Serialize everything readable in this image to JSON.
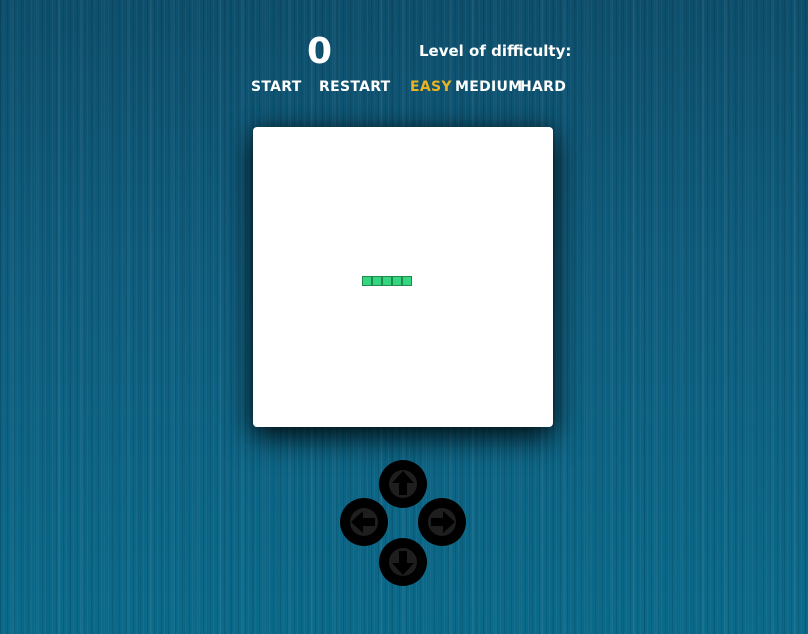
{
  "score": "0",
  "difficulty": {
    "title": "Level of difficulty:",
    "options": [
      "EASY",
      "MEDIUM",
      "HARD"
    ],
    "selected": "EASY",
    "selected_color": "#e8b423"
  },
  "controls": {
    "start_label": "START",
    "restart_label": "RESTART"
  },
  "board": {
    "background": "#ffffff"
  },
  "snake": {
    "length": 5,
    "direction": "horizontal",
    "color": "#34d67f",
    "border_color": "#1f8a4c"
  },
  "dpad": {
    "buttons": [
      "arrow-up-icon",
      "arrow-left-icon",
      "arrow-right-icon",
      "arrow-down-icon"
    ]
  },
  "colors": {
    "text": "#ffffff",
    "background": "#0e5a78",
    "dpad": "#000000"
  }
}
